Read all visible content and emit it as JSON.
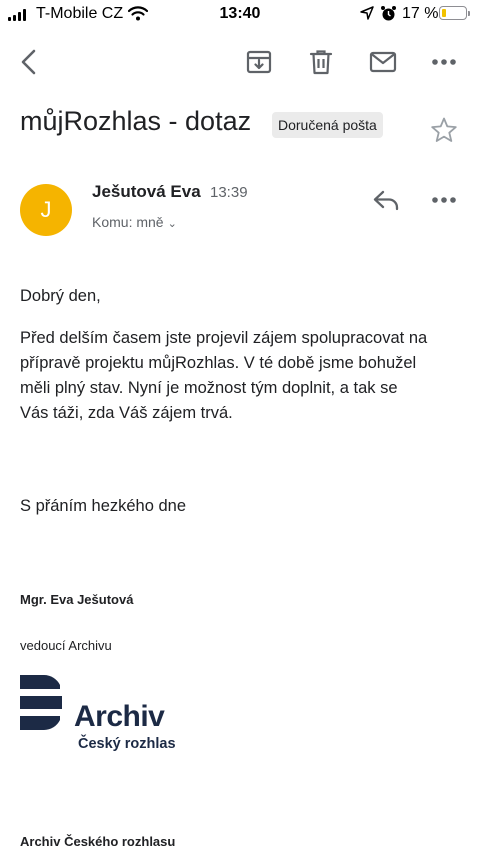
{
  "status_bar": {
    "carrier": "T-Mobile CZ",
    "time": "13:40",
    "battery_percent": "17 %",
    "battery_level": 0.17,
    "icons": [
      "signal-icon",
      "wifi-icon",
      "location-icon",
      "alarm-icon",
      "battery-icon"
    ]
  },
  "toolbar": {
    "icons": [
      "back-arrow-icon",
      "archive-icon",
      "trash-icon",
      "mail-icon",
      "more-icon"
    ]
  },
  "email": {
    "subject": "můjRozhlas - dotaz",
    "label": "Doručená pošta",
    "sender": "Ješutová Eva",
    "avatar_letter": "J",
    "avatar_color": "#f5b400",
    "time": "13:39",
    "to": "Komu: mně",
    "body": {
      "greeting": "Dobrý den,",
      "paragraph_lines": [
        "Před delším časem jste projevil zájem spolupracovat na",
        "přípravě projektu můjRozhlas. V té době jsme bohužel",
        "měli plný stav. Nyní je možnost tým doplnit, a tak se",
        "Vás táži, zda Váš zájem trvá."
      ],
      "closing": "S přáním hezkého dne"
    },
    "signature": {
      "name": "Mgr. Eva Ješutová",
      "role": "vedoucí Archivu",
      "logo_title": "Archiv",
      "logo_subtitle": "Český rozhlas",
      "organization": "Archiv Českého rozhlasu"
    }
  },
  "colors": {
    "logo_navy": "#1c2a45",
    "icon_gray": "#5f6368"
  }
}
